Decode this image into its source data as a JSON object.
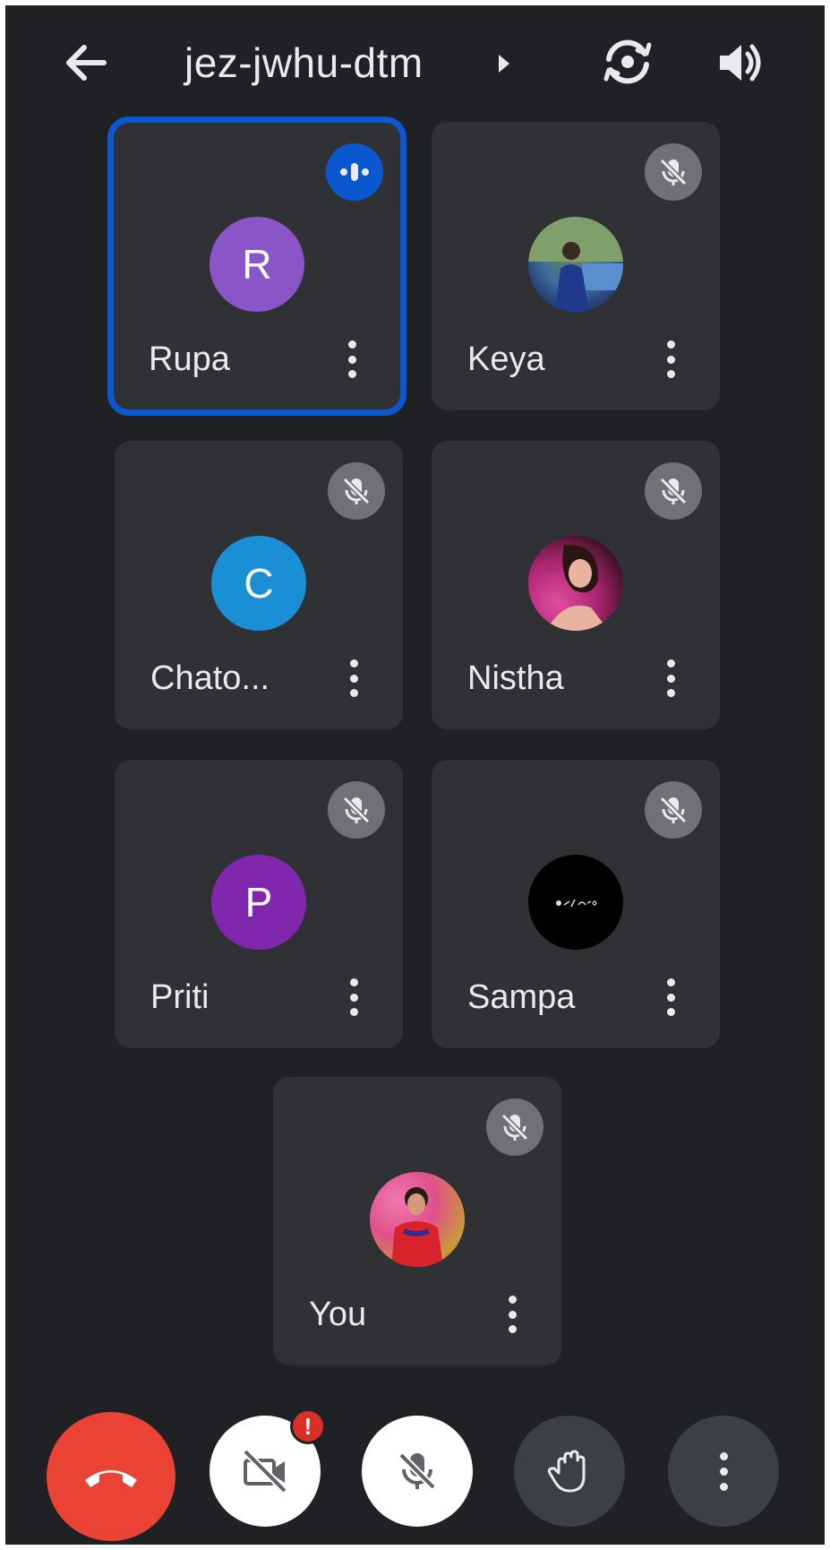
{
  "header": {
    "meeting_code": "jez-jwhu-dtm"
  },
  "participants": [
    {
      "name": "Rupa",
      "avatar_initial": "R",
      "avatar_color": "#8a55c7",
      "status": "speaking",
      "avatar_type": "initial"
    },
    {
      "name": "Keya",
      "avatar_initial": "",
      "avatar_color": "#4f79b4",
      "status": "muted",
      "avatar_type": "photo"
    },
    {
      "name": "Chato...",
      "avatar_initial": "C",
      "avatar_color": "#1a8fd6",
      "status": "muted",
      "avatar_type": "initial"
    },
    {
      "name": "Nistha",
      "avatar_initial": "",
      "avatar_color": "#b0307a",
      "status": "muted",
      "avatar_type": "photo"
    },
    {
      "name": "Priti",
      "avatar_initial": "P",
      "avatar_color": "#8127ae",
      "status": "muted",
      "avatar_type": "initial"
    },
    {
      "name": "Sampa",
      "avatar_initial": "",
      "avatar_color": "#000000",
      "status": "muted",
      "avatar_type": "photo"
    },
    {
      "name": "You",
      "avatar_initial": "",
      "avatar_color": "#d03a5a",
      "status": "muted",
      "avatar_type": "photo"
    }
  ],
  "controls": {
    "camera_alert": "!"
  },
  "colors": {
    "background": "#202124",
    "tile": "#303134",
    "active_outline": "#0b57d0",
    "end_call": "#ea4335",
    "muted_badge": "#6f7175"
  },
  "icons": {
    "back": "arrow-left-icon",
    "meeting_chevron": "triangle-right-icon",
    "flip_camera": "camera-flip-icon",
    "speaker": "speaker-icon",
    "speaking": "audio-wave-icon",
    "muted": "mic-off-icon",
    "more": "more-vertical-icon",
    "end_call": "phone-hangup-icon",
    "camera_off": "video-off-icon",
    "mic_off": "mic-off-icon",
    "raise_hand": "hand-icon",
    "overflow": "more-vertical-icon"
  }
}
